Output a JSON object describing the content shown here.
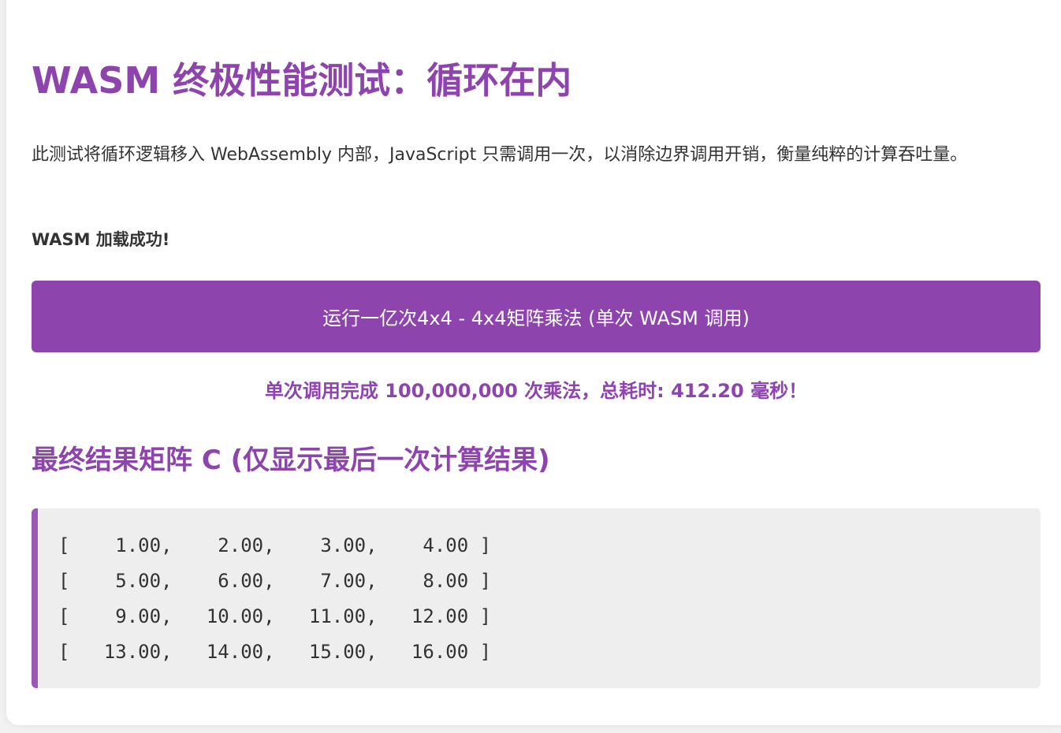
{
  "page": {
    "title": "WASM 终极性能测试：循环在内",
    "description": "此测试将循环逻辑移入 WebAssembly 内部，JavaScript 只需调用一次，以消除边界调用开销，衡量纯粹的计算吞吐量。",
    "load_status": "WASM 加载成功!",
    "run_button_label": "运行一亿次4x4 - 4x4矩阵乘法 (单次 WASM 调用)",
    "result_text": "单次调用完成 100,000,000 次乘法，总耗时: 412.20 毫秒！",
    "matrix_heading": "最终结果矩阵 C (仅显示最后一次计算结果)"
  },
  "matrix": {
    "rows": [
      "[    1.00,    2.00,    3.00,    4.00 ]",
      "[    5.00,    6.00,    7.00,    8.00 ]",
      "[    9.00,   10.00,   11.00,   12.00 ]",
      "[   13.00,   14.00,   15.00,   16.00 ]"
    ]
  },
  "colors": {
    "accent": "#8e44ad",
    "matrix_border": "#9b59b6",
    "text": "#333333",
    "matrix_bg": "#eeeeee"
  }
}
